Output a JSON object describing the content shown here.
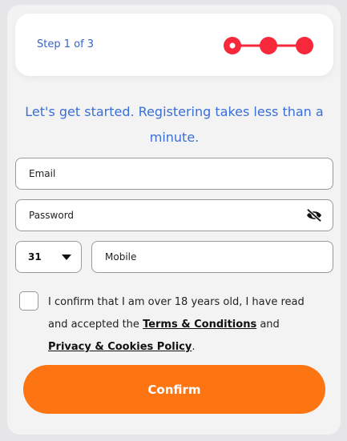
{
  "step": {
    "label": "Step 1 of 3",
    "current": 1,
    "total": 3
  },
  "headline": "Let's get started. Registering takes less than a minute.",
  "form": {
    "email_placeholder": "Email",
    "password_placeholder": "Password",
    "country_code": "31",
    "mobile_placeholder": "Mobile"
  },
  "consent": {
    "prefix": "I confirm that I am over 18 years old, I have read and accepted the ",
    "terms_link": "Terms & Conditions",
    "middle": " and ",
    "privacy_link": "Privacy & Cookies Policy",
    "suffix": "."
  },
  "confirm_label": "Confirm",
  "colors": {
    "accent": "#fd7412",
    "stepper": "#f7283c",
    "link_blue": "#3a6fd8"
  },
  "icons": {
    "password_toggle": "eye-slash-icon",
    "dropdown": "caret-down-icon"
  }
}
